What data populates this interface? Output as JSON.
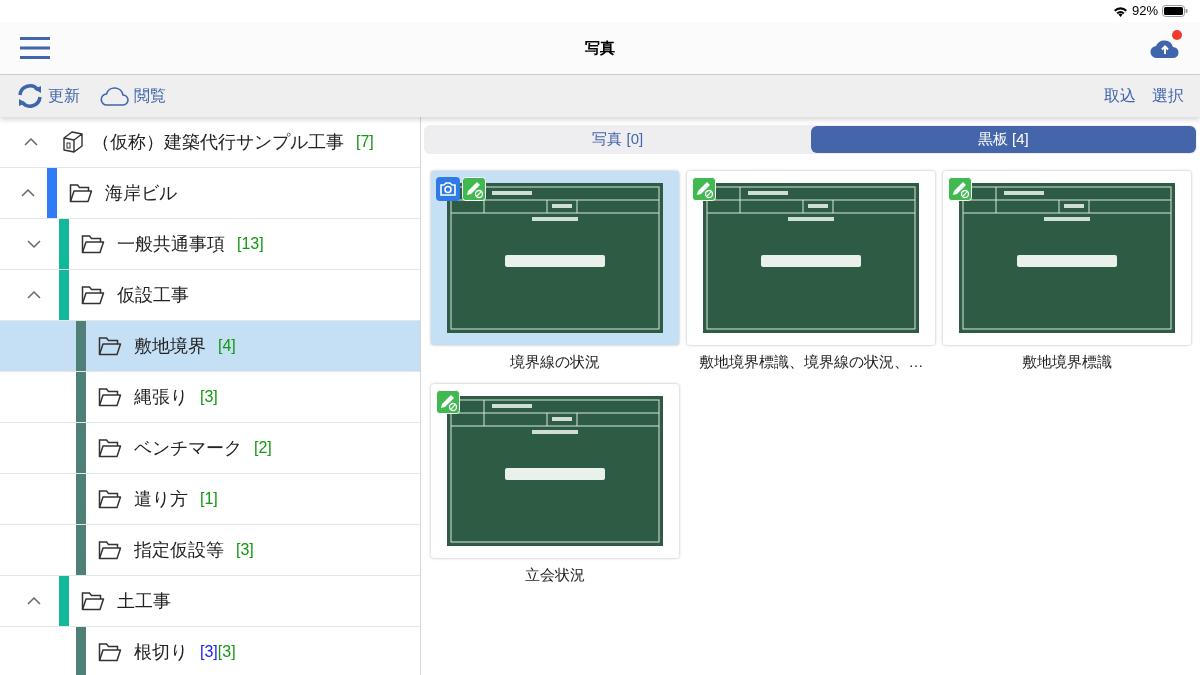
{
  "status_bar": {
    "battery": "92%"
  },
  "nav": {
    "title": "写真"
  },
  "toolbar": {
    "left": [
      "更新",
      "閲覧"
    ],
    "right": [
      "取込",
      "選択"
    ]
  },
  "tree": [
    {
      "label": "（仮称）建築代行サンプル工事",
      "expanded": true,
      "selected": false,
      "counts": [
        {
          "text": "[7]",
          "color": "#119911"
        }
      ],
      "children": [
        {
          "label": "海岸ビル",
          "expanded": true,
          "selected": false,
          "children": [
            {
              "label": "一般共通事項",
              "expanded": false,
              "selected": false,
              "counts": [
                {
                  "text": "[13]",
                  "color": "#119911"
                }
              ]
            },
            {
              "label": "仮設工事",
              "expanded": true,
              "selected": false,
              "children": [
                {
                  "label": "敷地境界",
                  "selected": true,
                  "counts": [
                    {
                      "text": "[4]",
                      "color": "#119911"
                    }
                  ]
                },
                {
                  "label": "縄張り",
                  "selected": false,
                  "counts": [
                    {
                      "text": "[3]",
                      "color": "#119911"
                    }
                  ]
                },
                {
                  "label": "ベンチマーク",
                  "selected": false,
                  "counts": [
                    {
                      "text": "[2]",
                      "color": "#119911"
                    }
                  ]
                },
                {
                  "label": "遣り方",
                  "selected": false,
                  "counts": [
                    {
                      "text": "[1]",
                      "color": "#119911"
                    }
                  ]
                },
                {
                  "label": "指定仮設等",
                  "selected": false,
                  "counts": [
                    {
                      "text": "[3]",
                      "color": "#119911"
                    }
                  ]
                }
              ]
            },
            {
              "label": "土工事",
              "expanded": true,
              "selected": false,
              "children": [
                {
                  "label": "根切り",
                  "selected": false,
                  "counts": [
                    {
                      "text": "[3]",
                      "color": "#1a1aff"
                    },
                    {
                      "text": "[3]",
                      "color": "#119911"
                    }
                  ]
                }
              ]
            }
          ]
        }
      ]
    }
  ],
  "tabs": [
    {
      "label": "写真 [0]",
      "selected": false
    },
    {
      "label": "黒板 [4]",
      "selected": true
    }
  ],
  "photos": [
    {
      "caption": "境界線の状況",
      "camera": true,
      "selected": true,
      "kind": "picture"
    },
    {
      "caption": "敷地境界標識、境界線の状況、…",
      "camera": false,
      "selected": false,
      "kind": "picture"
    },
    {
      "caption": "敷地境界標識",
      "camera": false,
      "selected": false,
      "kind": "picture"
    },
    {
      "caption": "立会状況",
      "camera": false,
      "selected": false,
      "kind": "picture"
    }
  ]
}
